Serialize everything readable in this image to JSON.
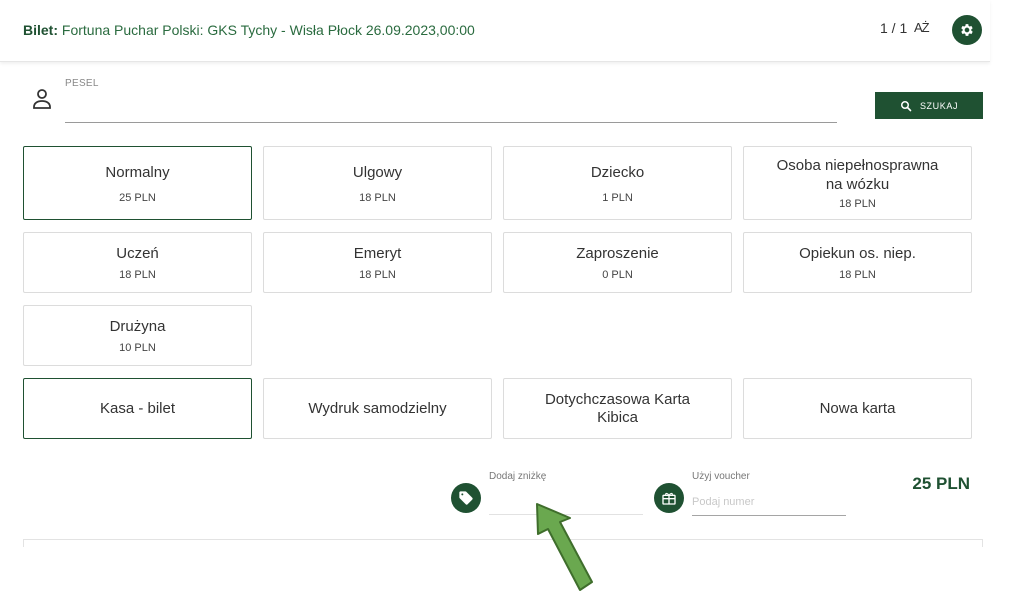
{
  "header": {
    "prefix": "Bilet:",
    "event": "Fortuna Puchar Polski: GKS Tychy - Wisła Płock 26.09.2023,00:00",
    "count": "1 / 1",
    "az_icon_glyph": "AŻ",
    "settings_icon": "gear-icon"
  },
  "pesel": {
    "label": "PESEL",
    "value": "",
    "icon": "person-icon"
  },
  "search_button": {
    "label": "SZUKAJ",
    "icon": "search-icon"
  },
  "ticket_types": [
    {
      "name": "Normalny",
      "price": "25 PLN",
      "selected": true
    },
    {
      "name": "Ulgowy",
      "price": "18 PLN",
      "selected": false
    },
    {
      "name": "Dziecko",
      "price": "1 PLN",
      "selected": false
    },
    {
      "name": "Osoba niepełnosprawna na wózku",
      "price": "18 PLN",
      "selected": false
    },
    {
      "name": "Uczeń",
      "price": "18 PLN",
      "selected": false
    },
    {
      "name": "Emeryt",
      "price": "18 PLN",
      "selected": false
    },
    {
      "name": "Zaproszenie",
      "price": "0 PLN",
      "selected": false
    },
    {
      "name": "Opiekun os. niep.",
      "price": "18 PLN",
      "selected": false
    },
    {
      "name": "Drużyna",
      "price": "10 PLN",
      "selected": false
    }
  ],
  "delivery_options": [
    {
      "name": "Kasa - bilet",
      "selected": true
    },
    {
      "name": "Wydruk samodzielny",
      "selected": false
    },
    {
      "name": "Dotychczasowa Karta Kibica",
      "selected": false
    },
    {
      "name": "Nowa karta",
      "selected": false
    }
  ],
  "discount": {
    "label": "Dodaj zniżkę",
    "value": "",
    "icon": "tag-icon"
  },
  "voucher": {
    "label": "Użyj voucher",
    "placeholder": "Podaj numer",
    "value": "",
    "icon": "gift-icon"
  },
  "total": "25 PLN",
  "colors": {
    "brand_green": "#1f5132",
    "arrow_green": "#6aa84f"
  }
}
